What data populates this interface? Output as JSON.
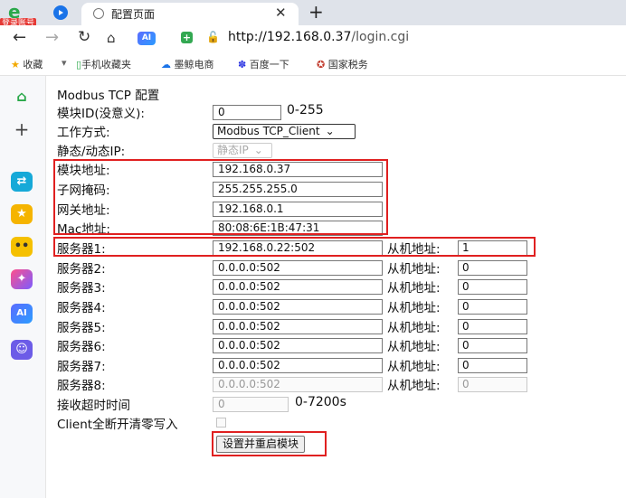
{
  "browser": {
    "brand_badge": "登录账号",
    "tab_title": "配置页面",
    "url_host": "http://192.168.0.37",
    "url_path": "/login.cgi",
    "ai_label": "AI",
    "bookmarks": [
      "收藏",
      "手机收藏夹",
      "墨鲸电商",
      "百度一下",
      "国家税务"
    ]
  },
  "sidebar": {
    "items": [
      "home-icon",
      "plus-icon",
      "translate-icon",
      "star-icon",
      "robot-icon",
      "ai-assistant-icon",
      "ai-icon",
      "chat-icon"
    ],
    "ai_label": "AI"
  },
  "form": {
    "heading": "Modbus TCP 配置",
    "module_id": {
      "label": "模块ID(没意义):",
      "value": "0",
      "range": "0-255"
    },
    "work_mode": {
      "label": "工作方式:",
      "value": "Modbus TCP_Client"
    },
    "ip_mode": {
      "label": "静态/动态IP:",
      "value": "静态IP"
    },
    "module_ip": {
      "label": "模块地址:",
      "value": "192.168.0.37"
    },
    "subnet": {
      "label": "子网掩码:",
      "value": "255.255.255.0"
    },
    "gateway": {
      "label": "网关地址:",
      "value": "192.168.0.1"
    },
    "mac": {
      "label": "Mac地址:",
      "value": "80:08:6E:1B:47:31"
    },
    "slave_label": "从机地址:",
    "servers": [
      {
        "label": "服务器1:",
        "value": "192.168.0.22:502",
        "slave": "1"
      },
      {
        "label": "服务器2:",
        "value": "0.0.0.0:502",
        "slave": "0"
      },
      {
        "label": "服务器3:",
        "value": "0.0.0.0:502",
        "slave": "0"
      },
      {
        "label": "服务器4:",
        "value": "0.0.0.0:502",
        "slave": "0"
      },
      {
        "label": "服务器5:",
        "value": "0.0.0.0:502",
        "slave": "0"
      },
      {
        "label": "服务器6:",
        "value": "0.0.0.0:502",
        "slave": "0"
      },
      {
        "label": "服务器7:",
        "value": "0.0.0.0:502",
        "slave": "0"
      },
      {
        "label": "服务器8:",
        "value": "0.0.0.0:502",
        "slave": "0"
      }
    ],
    "timeout": {
      "label": "接收超时时间",
      "value": "0",
      "range": "0-7200s"
    },
    "client_clear": {
      "label": "Client全断开清零写入"
    },
    "submit_label": "设置并重启模块"
  },
  "colors": {
    "highlight": "#e02020",
    "accent": "#1a73e8"
  }
}
